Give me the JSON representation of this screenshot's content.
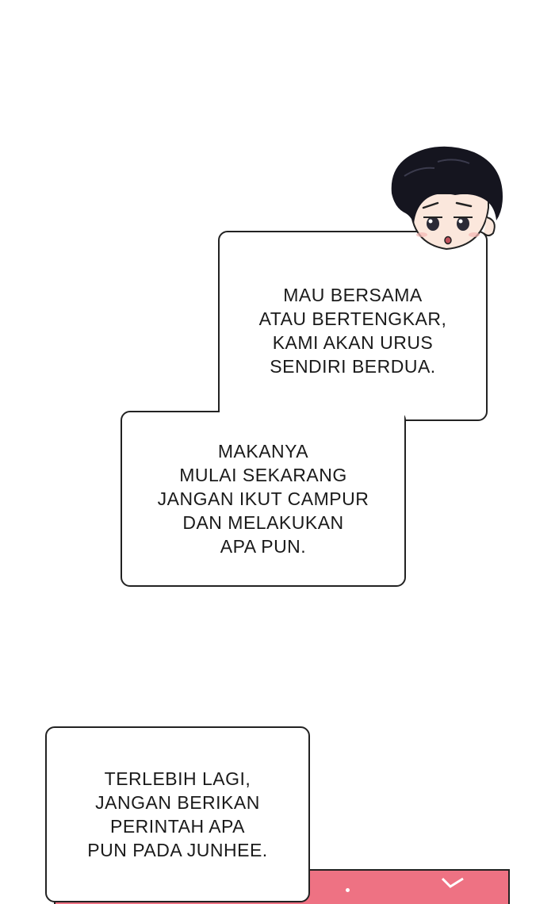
{
  "bubbles": [
    {
      "lines": [
        "MAU BERSAMA",
        "ATAU BERTENGKAR,",
        "KAMI AKAN URUS",
        "SENDIRI BERDUA."
      ]
    },
    {
      "lines": [
        "MAKANYA",
        "MULAI SEKARANG",
        "JANGAN IKUT CAMPUR",
        "DAN MELAKUKAN",
        "APA PUN."
      ]
    },
    {
      "lines": [
        "TERLEBIH LAGI,",
        "JANGAN BERIKAN",
        "PERINTAH APA",
        "PUN PADA JUNHEE."
      ]
    }
  ],
  "colors": {
    "panel_pink": "#ee7283",
    "outline": "#222222",
    "hair": "#15151f",
    "skin": "#fbe7dc"
  },
  "icons": {
    "avatar": "chibi-boy-head-icon"
  }
}
